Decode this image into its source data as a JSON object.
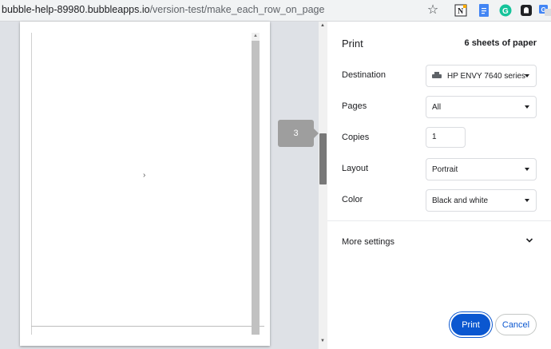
{
  "browser": {
    "url_host": "bubble-help-89980.bubbleapps.io",
    "url_path": "/version-test/make_each_row_on_page",
    "extensions": [
      {
        "name": "notion-web-clipper-icon",
        "glyph": "N"
      },
      {
        "name": "docs-icon",
        "glyph": ""
      },
      {
        "name": "grammarly-icon",
        "glyph": "G"
      },
      {
        "name": "ghostery-icon",
        "glyph": ""
      },
      {
        "name": "translate-icon",
        "glyph": "G"
      }
    ],
    "star_glyph": "☆"
  },
  "preview": {
    "page_tooltip": "3",
    "chevron": "›"
  },
  "print_panel": {
    "title": "Print",
    "sheets": "6 sheets of paper",
    "destination": {
      "label": "Destination",
      "value": "HP ENVY 7640 series"
    },
    "pages": {
      "label": "Pages",
      "value": "All"
    },
    "copies": {
      "label": "Copies",
      "value": "1"
    },
    "layout": {
      "label": "Layout",
      "value": "Portrait"
    },
    "color": {
      "label": "Color",
      "value": "Black and white"
    },
    "more_settings": "More settings",
    "print_button": "Print",
    "cancel_button": "Cancel"
  },
  "colors": {
    "accent": "#0b57d0",
    "background": "#dee1e6"
  }
}
